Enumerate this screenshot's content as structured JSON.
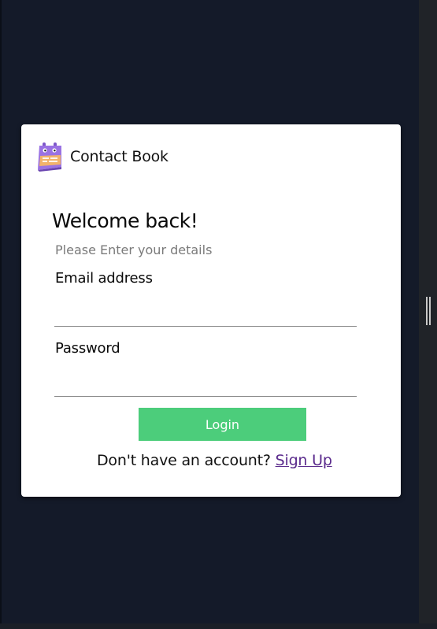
{
  "brand": {
    "name": "Contact Book",
    "logo_icon": "calendar-notebook-icon"
  },
  "login": {
    "heading": "Welcome back!",
    "subtitle": "Please Enter your details",
    "email_label": "Email address",
    "email_value": "",
    "password_label": "Password",
    "password_value": "",
    "submit_label": "Login",
    "no_account_text": "Don't have an account?",
    "signup_label": "Sign Up"
  },
  "colors": {
    "background": "#141a29",
    "card": "#ffffff",
    "button": "#4ccd7b",
    "link": "#5a2a8c"
  }
}
